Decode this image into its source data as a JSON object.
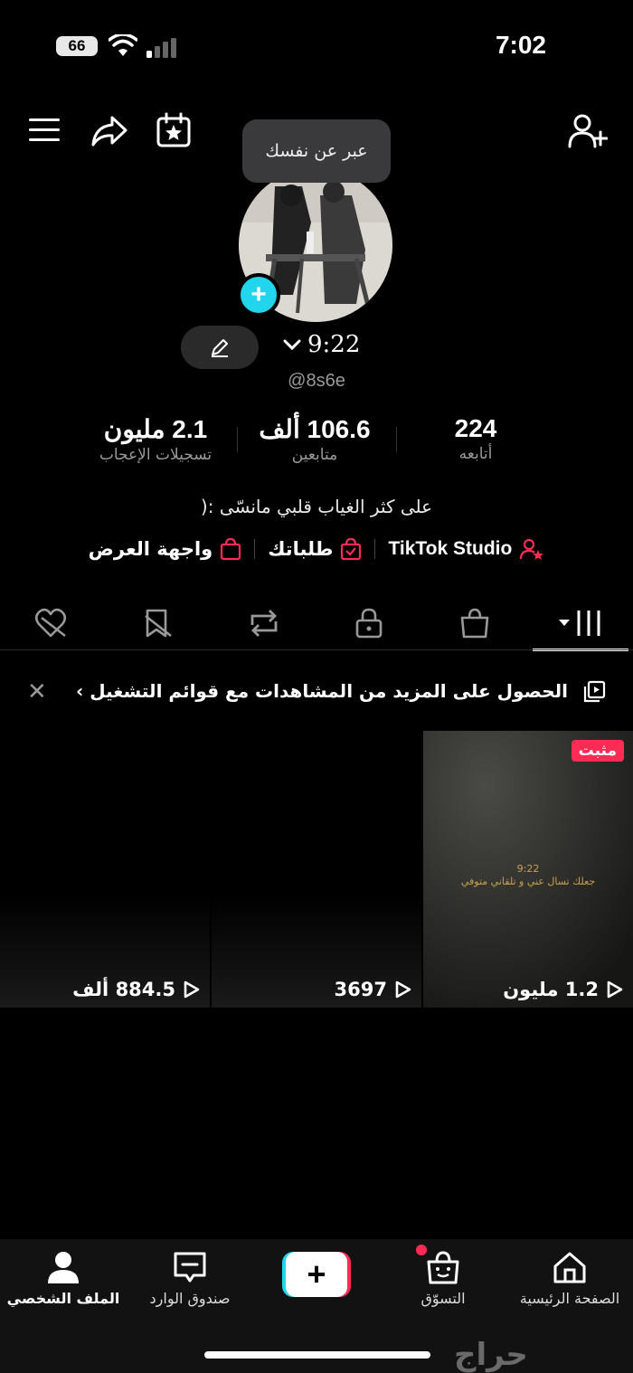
{
  "status_bar": {
    "time": "7:02",
    "battery": "66"
  },
  "tooltip": {
    "text": "عبر عن نفسك"
  },
  "profile": {
    "name": "9:22",
    "handle": "@8s6e",
    "bio": "على كثر الغياب قلبي مانسّى :("
  },
  "stats": [
    {
      "value": "224",
      "label": "أتابعه"
    },
    {
      "value": "106.6 ألف",
      "label": "متابعين"
    },
    {
      "value": "2.1 مليون",
      "label": "تسجيلات الإعجاب"
    }
  ],
  "links": [
    {
      "label": "TikTok Studio",
      "icon": "person-star-icon"
    },
    {
      "label": "طلباتك",
      "icon": "bag-check-icon"
    },
    {
      "label": "واجهة العرض",
      "icon": "bag-icon"
    }
  ],
  "tabs": [
    {
      "icon": "grid-icon",
      "active": true
    },
    {
      "icon": "shop-bag-icon"
    },
    {
      "icon": "lock-icon"
    },
    {
      "icon": "repost-icon"
    },
    {
      "icon": "bookmark-hidden-icon"
    },
    {
      "icon": "heart-hidden-icon"
    }
  ],
  "banner": {
    "text": "الحصول على المزيد من المشاهدات مع قوائم التشغيل ›"
  },
  "videos": [
    {
      "views": "1.2 مليون",
      "pinned_label": "مثبت",
      "overlay_title": "9:22",
      "overlay_text": "جعلك تسال عني و تلقاني متوفي"
    },
    {
      "views": "3697"
    },
    {
      "views": "884.5 ألف"
    }
  ],
  "nav": [
    {
      "label": "الصفحة الرئيسية",
      "icon": "home-icon"
    },
    {
      "label": "التسوّق",
      "icon": "shop-icon"
    },
    {
      "label": "",
      "icon": "plus-icon"
    },
    {
      "label": "صندوق الوارد",
      "icon": "inbox-icon"
    },
    {
      "label": "الملف الشخصي",
      "icon": "profile-icon"
    }
  ],
  "watermark": "حراج",
  "colors": {
    "accent_red": "#fe2c55",
    "accent_cyan": "#20d5ec",
    "background": "#000000"
  }
}
